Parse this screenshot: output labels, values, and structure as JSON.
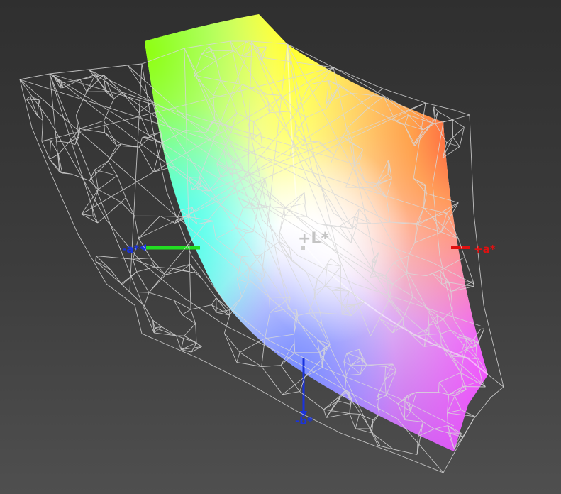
{
  "axes": {
    "l_plus": "+L*",
    "a_plus": "+a*",
    "a_minus": "-a*",
    "b_minus": "-b*"
  },
  "colors": {
    "background_top": "#2f2f2f",
    "background_bottom": "#4f4f4f",
    "wireframe": "#d8d8d8",
    "axis_a_plus": "#e01010",
    "axis_a_minus": "#22dd22",
    "axis_b_minus": "#1a33dd",
    "axis_L": "#c8c8c8"
  },
  "icons": {
    "wireframe_gamut": "reference-gamut-wireframe",
    "solid_gamut": "measured-gamut-solid"
  }
}
